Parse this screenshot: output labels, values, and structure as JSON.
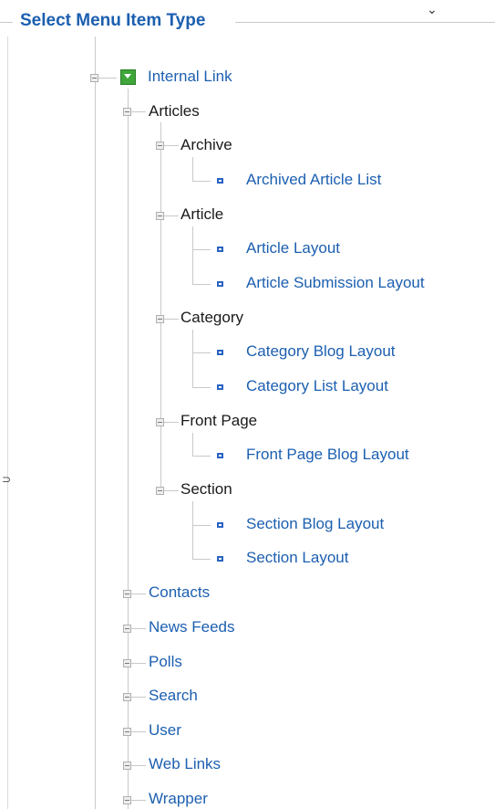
{
  "legend": "Select Menu Item Type",
  "tree": {
    "root": "Internal Link",
    "articles": "Articles",
    "archive": "Archive",
    "archived_article_list": "Archived Article List",
    "article": "Article",
    "article_layout": "Article Layout",
    "article_submission_layout": "Article Submission Layout",
    "category": "Category",
    "category_blog_layout": "Category Blog Layout",
    "category_list_layout": "Category List Layout",
    "front_page": "Front Page",
    "front_page_blog_layout": "Front Page Blog Layout",
    "section": "Section",
    "section_blog_layout": "Section Blog Layout",
    "section_layout": "Section Layout",
    "contacts": "Contacts",
    "news_feeds": "News Feeds",
    "polls": "Polls",
    "search": "Search",
    "user": "User",
    "web_links": "Web Links",
    "wrapper": "Wrapper"
  },
  "icons": {
    "root_icon": "green-folder-icon",
    "leaf_icon": "leaf-bullet-icon",
    "expander_icon": "expander-icon"
  },
  "colors": {
    "link": "#1c5fb0",
    "legend": "#1c5fb0",
    "folder_green": "#3fa63a"
  }
}
